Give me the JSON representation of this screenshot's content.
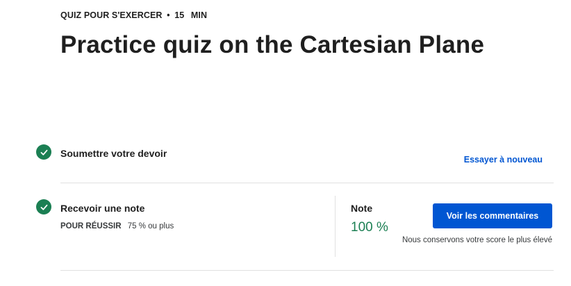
{
  "header": {
    "type_label": "QUIZ POUR S'EXERCER",
    "separator": "•",
    "duration": "15",
    "duration_unit": "MIN",
    "title": "Practice quiz on the Cartesian Plane"
  },
  "steps": {
    "submit": {
      "label": "Soumettre votre devoir",
      "status": "completed",
      "action_label": "Essayer à nouveau"
    },
    "grade": {
      "label": "Recevoir une note",
      "status": "completed",
      "pass_label": "POUR RÉUSSIR",
      "pass_value": "75 % ou plus",
      "grade_label": "Note",
      "grade_value": "100 %",
      "grade_note": "Nous conservons votre score le plus élevé",
      "feedback_button": "Voir les commentaires"
    }
  },
  "colors": {
    "accent": "#0056d2",
    "success": "#1b7f53",
    "divider": "#e0e0e0"
  },
  "icons": {
    "check": "check-circle-icon"
  }
}
